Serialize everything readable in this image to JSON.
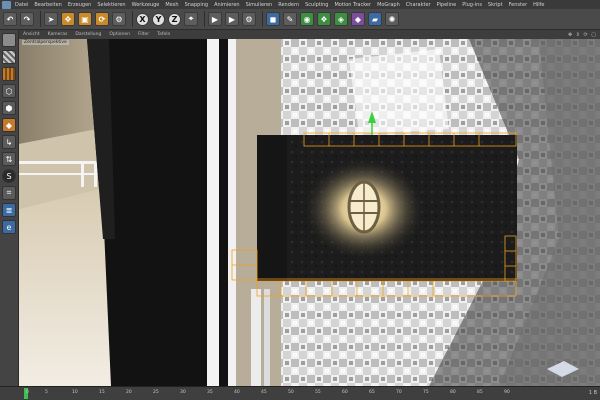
{
  "menubar": {
    "items": [
      "Datei",
      "Bearbeiten",
      "Erzeugen",
      "Selektieren",
      "Werkzeuge",
      "Mesh",
      "Snapping",
      "Animieren",
      "Simulieren",
      "Rendern",
      "Sculpting",
      "Motion Tracker",
      "MoGraph",
      "Charakter",
      "Pipeline",
      "Plug-ins",
      "Skript",
      "Fenster",
      "Hilfe"
    ]
  },
  "toolbar": {
    "axis_x": "X",
    "axis_y": "Y",
    "axis_z": "Z"
  },
  "viewport": {
    "menu": [
      "Ansicht",
      "Kameras",
      "Darstellung",
      "Optionen",
      "Filter",
      "Tafeln"
    ],
    "label": "Zentralperspektive"
  },
  "timeline": {
    "ticks": [
      "0",
      "5",
      "10",
      "15",
      "20",
      "25",
      "30",
      "35",
      "40",
      "45",
      "50",
      "55",
      "60",
      "65",
      "70",
      "75",
      "80",
      "85",
      "90"
    ],
    "end_label": "1 B"
  }
}
